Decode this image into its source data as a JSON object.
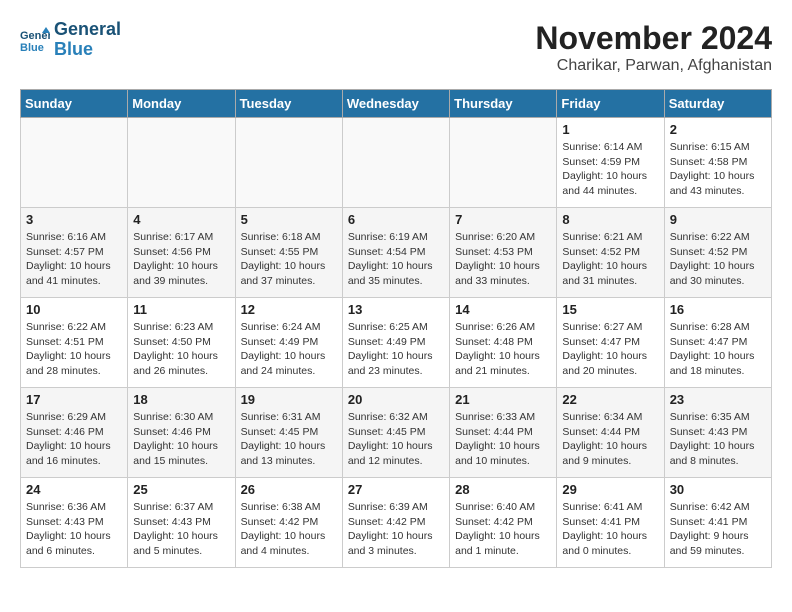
{
  "logo": {
    "line1": "General",
    "line2": "Blue"
  },
  "title": "November 2024",
  "location": "Charikar, Parwan, Afghanistan",
  "headers": [
    "Sunday",
    "Monday",
    "Tuesday",
    "Wednesday",
    "Thursday",
    "Friday",
    "Saturday"
  ],
  "weeks": [
    [
      {
        "day": "",
        "info": ""
      },
      {
        "day": "",
        "info": ""
      },
      {
        "day": "",
        "info": ""
      },
      {
        "day": "",
        "info": ""
      },
      {
        "day": "",
        "info": ""
      },
      {
        "day": "1",
        "info": "Sunrise: 6:14 AM\nSunset: 4:59 PM\nDaylight: 10 hours\nand 44 minutes."
      },
      {
        "day": "2",
        "info": "Sunrise: 6:15 AM\nSunset: 4:58 PM\nDaylight: 10 hours\nand 43 minutes."
      }
    ],
    [
      {
        "day": "3",
        "info": "Sunrise: 6:16 AM\nSunset: 4:57 PM\nDaylight: 10 hours\nand 41 minutes."
      },
      {
        "day": "4",
        "info": "Sunrise: 6:17 AM\nSunset: 4:56 PM\nDaylight: 10 hours\nand 39 minutes."
      },
      {
        "day": "5",
        "info": "Sunrise: 6:18 AM\nSunset: 4:55 PM\nDaylight: 10 hours\nand 37 minutes."
      },
      {
        "day": "6",
        "info": "Sunrise: 6:19 AM\nSunset: 4:54 PM\nDaylight: 10 hours\nand 35 minutes."
      },
      {
        "day": "7",
        "info": "Sunrise: 6:20 AM\nSunset: 4:53 PM\nDaylight: 10 hours\nand 33 minutes."
      },
      {
        "day": "8",
        "info": "Sunrise: 6:21 AM\nSunset: 4:52 PM\nDaylight: 10 hours\nand 31 minutes."
      },
      {
        "day": "9",
        "info": "Sunrise: 6:22 AM\nSunset: 4:52 PM\nDaylight: 10 hours\nand 30 minutes."
      }
    ],
    [
      {
        "day": "10",
        "info": "Sunrise: 6:22 AM\nSunset: 4:51 PM\nDaylight: 10 hours\nand 28 minutes."
      },
      {
        "day": "11",
        "info": "Sunrise: 6:23 AM\nSunset: 4:50 PM\nDaylight: 10 hours\nand 26 minutes."
      },
      {
        "day": "12",
        "info": "Sunrise: 6:24 AM\nSunset: 4:49 PM\nDaylight: 10 hours\nand 24 minutes."
      },
      {
        "day": "13",
        "info": "Sunrise: 6:25 AM\nSunset: 4:49 PM\nDaylight: 10 hours\nand 23 minutes."
      },
      {
        "day": "14",
        "info": "Sunrise: 6:26 AM\nSunset: 4:48 PM\nDaylight: 10 hours\nand 21 minutes."
      },
      {
        "day": "15",
        "info": "Sunrise: 6:27 AM\nSunset: 4:47 PM\nDaylight: 10 hours\nand 20 minutes."
      },
      {
        "day": "16",
        "info": "Sunrise: 6:28 AM\nSunset: 4:47 PM\nDaylight: 10 hours\nand 18 minutes."
      }
    ],
    [
      {
        "day": "17",
        "info": "Sunrise: 6:29 AM\nSunset: 4:46 PM\nDaylight: 10 hours\nand 16 minutes."
      },
      {
        "day": "18",
        "info": "Sunrise: 6:30 AM\nSunset: 4:46 PM\nDaylight: 10 hours\nand 15 minutes."
      },
      {
        "day": "19",
        "info": "Sunrise: 6:31 AM\nSunset: 4:45 PM\nDaylight: 10 hours\nand 13 minutes."
      },
      {
        "day": "20",
        "info": "Sunrise: 6:32 AM\nSunset: 4:45 PM\nDaylight: 10 hours\nand 12 minutes."
      },
      {
        "day": "21",
        "info": "Sunrise: 6:33 AM\nSunset: 4:44 PM\nDaylight: 10 hours\nand 10 minutes."
      },
      {
        "day": "22",
        "info": "Sunrise: 6:34 AM\nSunset: 4:44 PM\nDaylight: 10 hours\nand 9 minutes."
      },
      {
        "day": "23",
        "info": "Sunrise: 6:35 AM\nSunset: 4:43 PM\nDaylight: 10 hours\nand 8 minutes."
      }
    ],
    [
      {
        "day": "24",
        "info": "Sunrise: 6:36 AM\nSunset: 4:43 PM\nDaylight: 10 hours\nand 6 minutes."
      },
      {
        "day": "25",
        "info": "Sunrise: 6:37 AM\nSunset: 4:43 PM\nDaylight: 10 hours\nand 5 minutes."
      },
      {
        "day": "26",
        "info": "Sunrise: 6:38 AM\nSunset: 4:42 PM\nDaylight: 10 hours\nand 4 minutes."
      },
      {
        "day": "27",
        "info": "Sunrise: 6:39 AM\nSunset: 4:42 PM\nDaylight: 10 hours\nand 3 minutes."
      },
      {
        "day": "28",
        "info": "Sunrise: 6:40 AM\nSunset: 4:42 PM\nDaylight: 10 hours\nand 1 minute."
      },
      {
        "day": "29",
        "info": "Sunrise: 6:41 AM\nSunset: 4:41 PM\nDaylight: 10 hours\nand 0 minutes."
      },
      {
        "day": "30",
        "info": "Sunrise: 6:42 AM\nSunset: 4:41 PM\nDaylight: 9 hours\nand 59 minutes."
      }
    ]
  ]
}
